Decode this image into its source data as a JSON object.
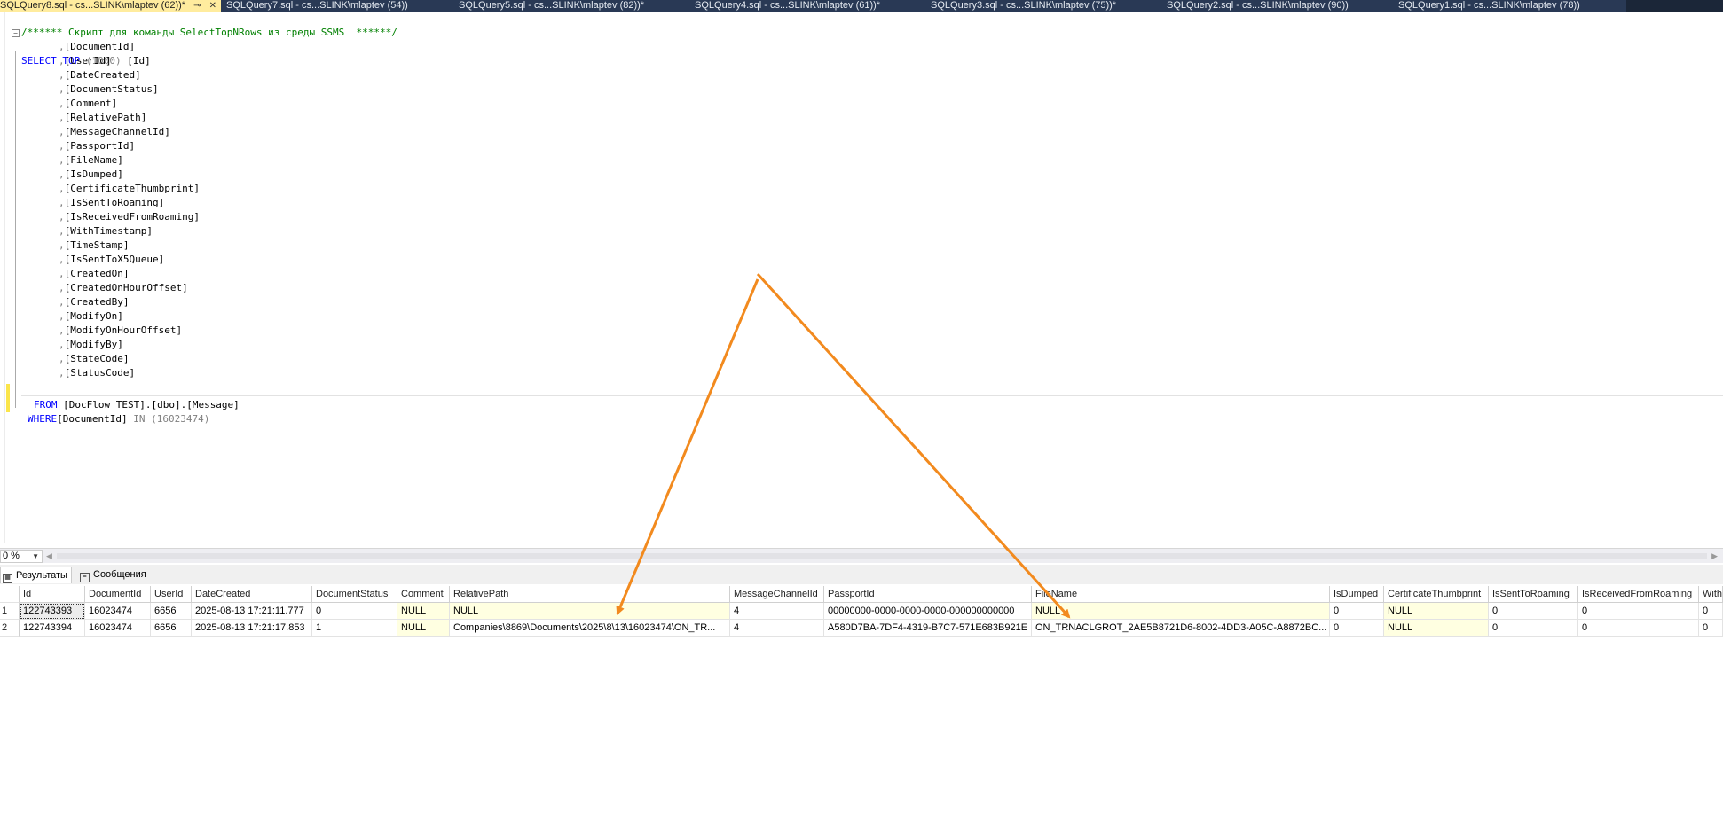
{
  "tabs": [
    {
      "label": "SQLQuery8.sql - cs...SLINK\\mlaptev (62))*",
      "active": true
    },
    {
      "label": "SQLQuery7.sql - cs...SLINK\\mlaptev (54))"
    },
    {
      "label": "SQLQuery5.sql - cs...SLINK\\mlaptev (82))*"
    },
    {
      "label": "SQLQuery4.sql - cs...SLINK\\mlaptev (61))*"
    },
    {
      "label": "SQLQuery3.sql - cs...SLINK\\mlaptev (75))*"
    },
    {
      "label": "SQLQuery2.sql - cs...SLINK\\mlaptev (90))"
    },
    {
      "label": "SQLQuery1.sql - cs...SLINK\\mlaptev (78))"
    }
  ],
  "tab_icons": {
    "pin": "⊸",
    "close": "✕"
  },
  "editor": {
    "comment": "/****** Скрипт для команды SelectTopNRows из среды SSMS  ******/",
    "select_kw": "SELECT",
    "top_kw": "TOP",
    "top_value": "(1000)",
    "first_column": "[Id]",
    "columns": [
      "[DocumentId]",
      "[UserId]",
      "[DateCreated]",
      "[DocumentStatus]",
      "[Comment]",
      "[RelativePath]",
      "[MessageChannelId]",
      "[PassportId]",
      "[FileName]",
      "[IsDumped]",
      "[CertificateThumbprint]",
      "[IsSentToRoaming]",
      "[IsReceivedFromRoaming]",
      "[WithTimestamp]",
      "[TimeStamp]",
      "[IsSentToX5Queue]",
      "[CreatedOn]",
      "[CreatedOnHourOffset]",
      "[CreatedBy]",
      "[ModifyOn]",
      "[ModifyOnHourOffset]",
      "[ModifyBy]",
      "[StateCode]",
      "[StatusCode]"
    ],
    "comma": ",",
    "from_kw": "FROM",
    "from_table": "[DocFlow_TEST].[dbo].[Message]",
    "where_kw": "WHERE",
    "where_col": "[DocumentId]",
    "in_kw": "IN",
    "in_value": "(16023474)"
  },
  "zoom": {
    "value": "0 %"
  },
  "results_tabs": [
    {
      "label": "Результаты",
      "active": true
    },
    {
      "label": "Сообщения"
    }
  ],
  "grid": {
    "columns": [
      "Id",
      "DocumentId",
      "UserId",
      "DateCreated",
      "DocumentStatus",
      "Comment",
      "RelativePath",
      "MessageChannelId",
      "PassportId",
      "FileName",
      "IsDumped",
      "CertificateThumbprint",
      "IsSentToRoaming",
      "IsReceivedFromRoaming",
      "With"
    ],
    "rows": [
      {
        "num": "1",
        "cells": [
          "122743393",
          "16023474",
          "6656",
          "2025-08-13 17:21:11.777",
          "0",
          "NULL",
          "NULL",
          "4",
          "00000000-0000-0000-0000-000000000000",
          "NULL",
          "0",
          "NULL",
          "0",
          "0",
          "0"
        ]
      },
      {
        "num": "2",
        "cells": [
          "122743394",
          "16023474",
          "6656",
          "2025-08-13 17:21:17.853",
          "1",
          "NULL",
          "Companies\\8869\\Documents\\2025\\8\\13\\16023474\\ON_TR...",
          "4",
          "A580D7BA-7DF4-4319-B7C7-571E683B921E",
          "ON_TRNACLGROT_2AE5B8721D6-8002-4DD3-A05C-A8872BC...",
          "0",
          "NULL",
          "0",
          "0",
          "0"
        ]
      }
    ]
  },
  "colors": {
    "annotation_arrow": "#f28a1e",
    "tab_bar": "#293955",
    "active_tab": "#ffec9e",
    "keyword": "#0000ff",
    "comment": "#008000",
    "null_cell": "#ffffe1"
  }
}
